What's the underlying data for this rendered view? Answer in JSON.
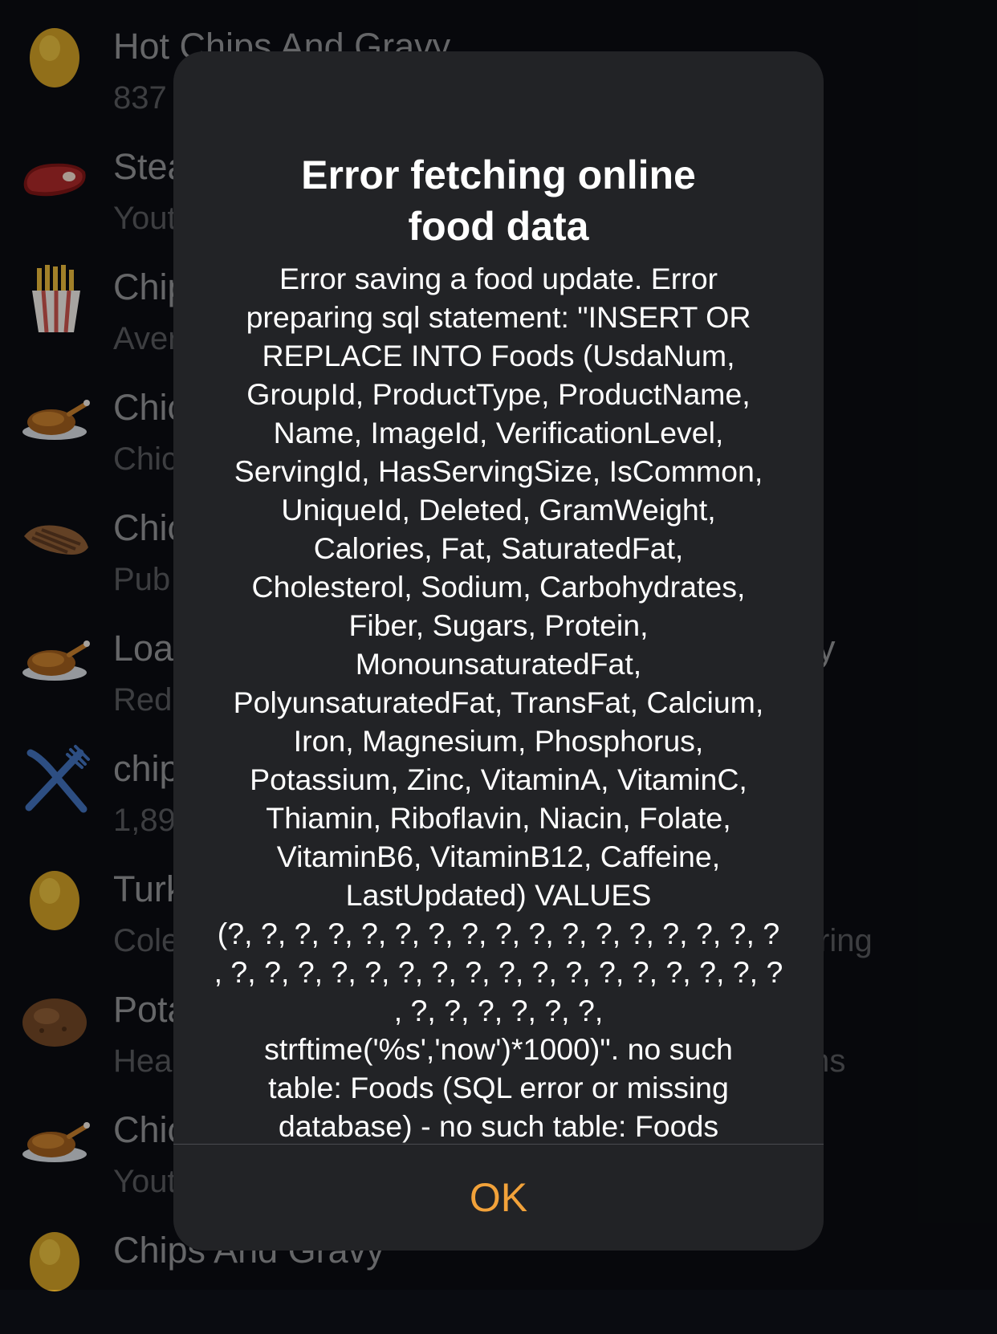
{
  "food_list": {
    "items": [
      {
        "title": "Hot Chips And Gravy",
        "subtitle": "837",
        "icon": "potato-icon"
      },
      {
        "title": "Stea",
        "subtitle": "Yout",
        "icon": "steak-icon"
      },
      {
        "title": "Chip",
        "subtitle": "Aver",
        "icon": "fries-icon"
      },
      {
        "title": "Chic",
        "subtitle": "Chic",
        "icon": "roast-chicken-icon"
      },
      {
        "title": "Chic",
        "subtitle": "Pub",
        "icon": "chicken-breast-icon"
      },
      {
        "title": "Loa",
        "subtitle": "Red",
        "icon": "roast-chicken-icon"
      },
      {
        "title": "chip",
        "subtitle": "1,89",
        "icon": "fork-knife-icon"
      },
      {
        "title": "Turk",
        "subtitle": "Cole",
        "icon": "potato-icon"
      },
      {
        "title": "Pota",
        "subtitle": "Hea",
        "icon": "baked-potato-icon"
      },
      {
        "title": "Chic",
        "subtitle": "Yout",
        "icon": "roast-chicken-icon"
      },
      {
        "title": "Chips And Gravy",
        "subtitle": "",
        "icon": "potato-icon"
      }
    ],
    "right_fragments": {
      "row5": "y",
      "row8": "ring",
      "row9": "ms"
    }
  },
  "alert": {
    "title_lines": [
      "Error fetching online",
      "food data"
    ],
    "message_lines": [
      "Error saving a food update. Error",
      "preparing sql statement: \"INSERT OR",
      "REPLACE INTO Foods (UsdaNum,",
      "GroupId, ProductType, ProductName,",
      "Name, ImageId, VerificationLevel,",
      "ServingId, HasServingSize, IsCommon,",
      "UniqueId, Deleted, GramWeight,",
      "Calories, Fat, SaturatedFat,",
      "Cholesterol, Sodium, Carbohydrates,",
      "Fiber, Sugars, Protein,",
      "MonounsaturatedFat,",
      "PolyunsaturatedFat, TransFat, Calcium,",
      "Iron, Magnesium, Phosphorus,",
      "Potassium, Zinc, VitaminA, VitaminC,",
      "Thiamin, Riboflavin, Niacin, Folate,",
      "VitaminB6, VitaminB12, Caffeine,",
      "LastUpdated) VALUES",
      "(?, ?, ?, ?, ?, ?, ?, ?, ?, ?, ?, ?, ?, ?, ?, ?, ?",
      ", ?, ?, ?, ?, ?, ?, ?, ?, ?, ?, ?, ?, ?, ?, ?, ?, ?",
      ", ?, ?, ?, ?, ?, ?,",
      "strftime('%s','now')*1000)\". no such",
      "table: Foods (SQL error or missing",
      "database) - no such table: Foods"
    ],
    "ok_label": "OK"
  },
  "colors": {
    "background": "#0a0c11",
    "alert_background": "#222326",
    "accent": "#f2a23a"
  }
}
